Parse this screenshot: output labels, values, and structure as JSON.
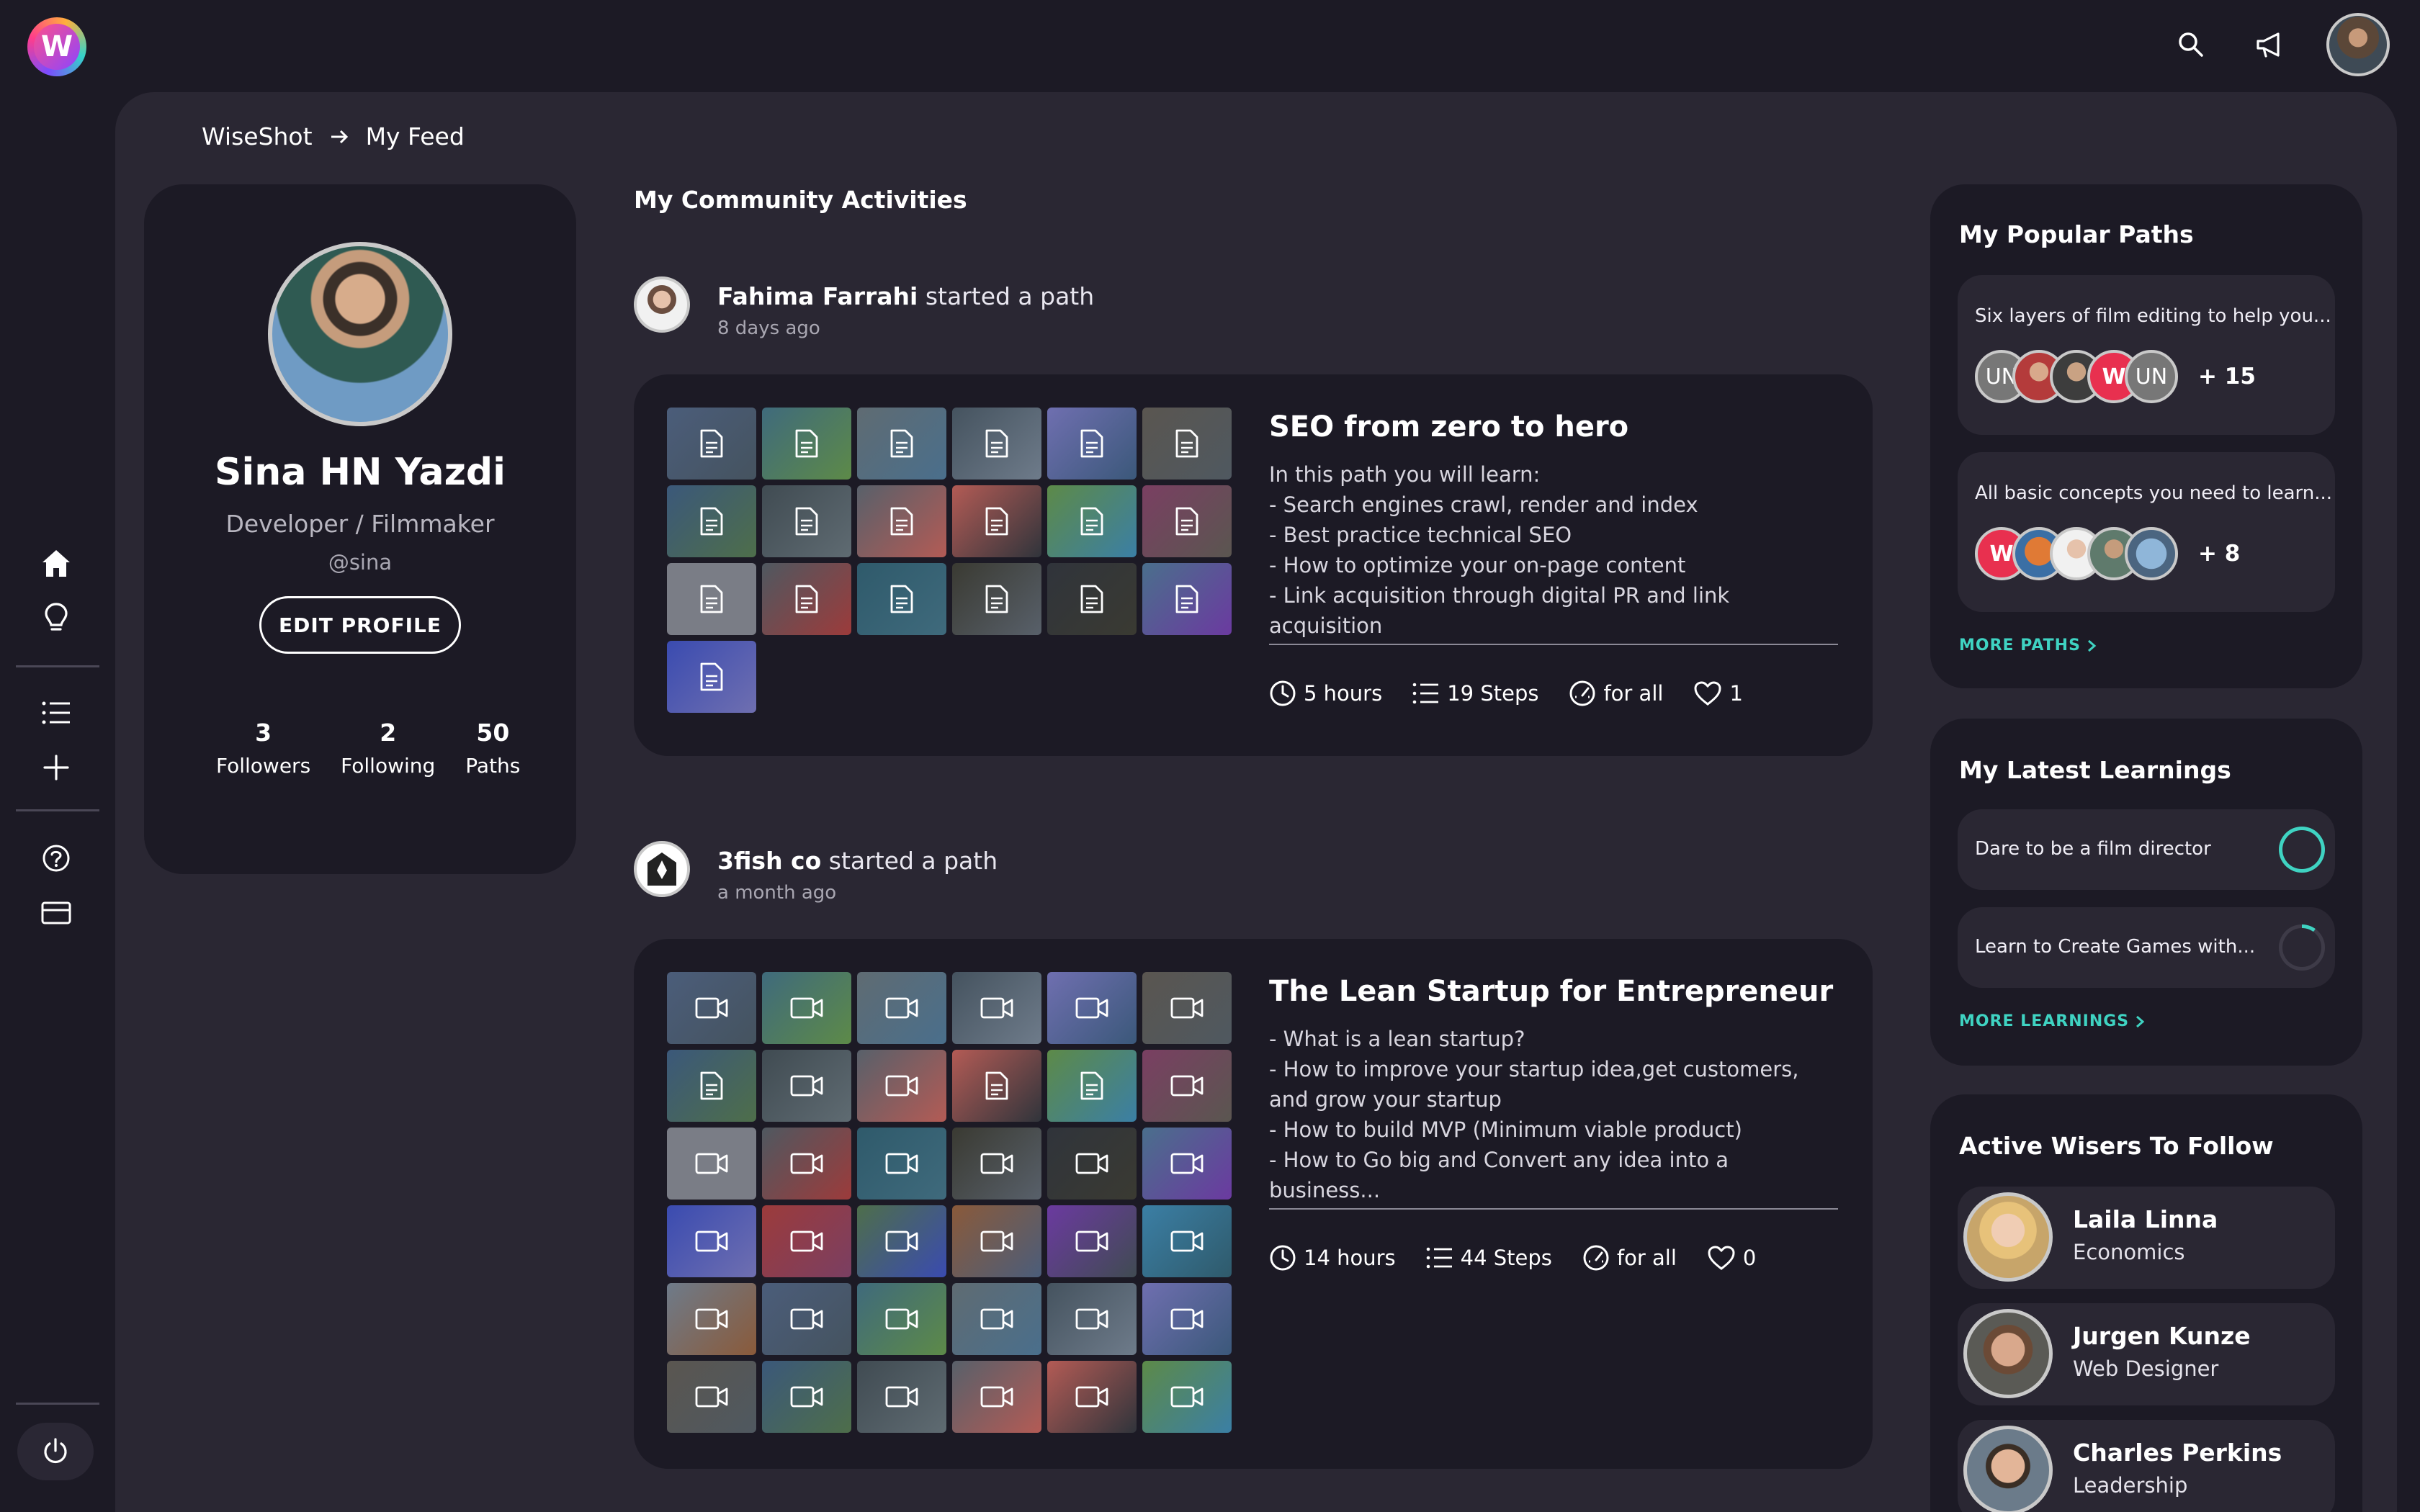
{
  "app": {
    "logo_letter": "W"
  },
  "topbar": {
    "icons": [
      "search-icon",
      "megaphone-icon"
    ]
  },
  "leftnav": {
    "items": [
      "home-icon",
      "lightbulb-icon",
      "list-icon",
      "plus-icon",
      "help-icon",
      "card-icon"
    ],
    "power": "power-icon"
  },
  "breadcrumb": {
    "root": "WiseShot",
    "current": "My Feed"
  },
  "profile": {
    "name": "Sina HN Yazdi",
    "role": "Developer / Filmmaker",
    "handle": "@sina",
    "edit_label": "EDIT PROFILE",
    "stats": [
      {
        "num": "3",
        "label": "Followers"
      },
      {
        "num": "2",
        "label": "Following"
      },
      {
        "num": "50",
        "label": "Paths"
      }
    ]
  },
  "feed": {
    "title": "My Community Activities",
    "activities": [
      {
        "user": "Fahima Farrahi",
        "action": "started a path",
        "time": "8 days ago",
        "path": {
          "title": "SEO from zero to hero",
          "description": [
            "In this path you will learn:",
            "- Search engines crawl, render and index",
            "- Best practice technical SEO",
            "- How to optimize your on-page content",
            "- Link acquisition through digital PR and link acquisition"
          ],
          "duration": "5 hours",
          "steps": "19 Steps",
          "audience": "for all",
          "likes": "1",
          "thumbs": [
            "doc",
            "doc",
            "doc",
            "doc",
            "doc",
            "doc",
            "doc",
            "doc",
            "doc",
            "doc",
            "doc",
            "doc",
            "doc",
            "doc",
            "doc",
            "doc",
            "doc",
            "doc",
            "doc"
          ]
        }
      },
      {
        "user": "3fish co",
        "action": "started a path",
        "time": "a month ago",
        "path": {
          "title": "The Lean Startup for Entrepreneur",
          "description": [
            "- What is a lean startup?",
            "- How to improve your startup idea,get customers, and grow your startup",
            "- How to build MVP (Minimum viable product)",
            "- How to Go big and Convert any idea into a business..."
          ],
          "duration": "14 hours",
          "steps": "44 Steps",
          "audience": "for all",
          "likes": "0"
        }
      }
    ]
  },
  "popular_paths": {
    "title": "My Popular Paths",
    "items": [
      {
        "title": "Six layers of film editing to help you...",
        "count": "+ 15",
        "avatars": [
          "UN",
          "",
          "",
          "W",
          "UN"
        ]
      },
      {
        "title": "All basic concepts you need to learn...",
        "count": "+ 8",
        "avatars": [
          "W",
          "",
          "",
          "",
          ""
        ]
      }
    ],
    "more": "MORE PATHS"
  },
  "latest_learnings": {
    "title": "My Latest Learnings",
    "items": [
      {
        "title": "Dare to be a film director",
        "progress": 1.0
      },
      {
        "title": "Learn to Create Games with...",
        "progress": 0.1
      }
    ],
    "more": "MORE LEARNINGS"
  },
  "wisers": {
    "title": "Active Wisers To Follow",
    "items": [
      {
        "name": "Laila Linna",
        "role": "Economics"
      },
      {
        "name": "Jurgen Kunze",
        "role": "Web Designer"
      },
      {
        "name": "Charles Perkins",
        "role": "Leadership"
      }
    ]
  },
  "colors": {
    "accent": "#3fd3c2",
    "background": "#1c1a25",
    "panel": "#2a2733"
  }
}
